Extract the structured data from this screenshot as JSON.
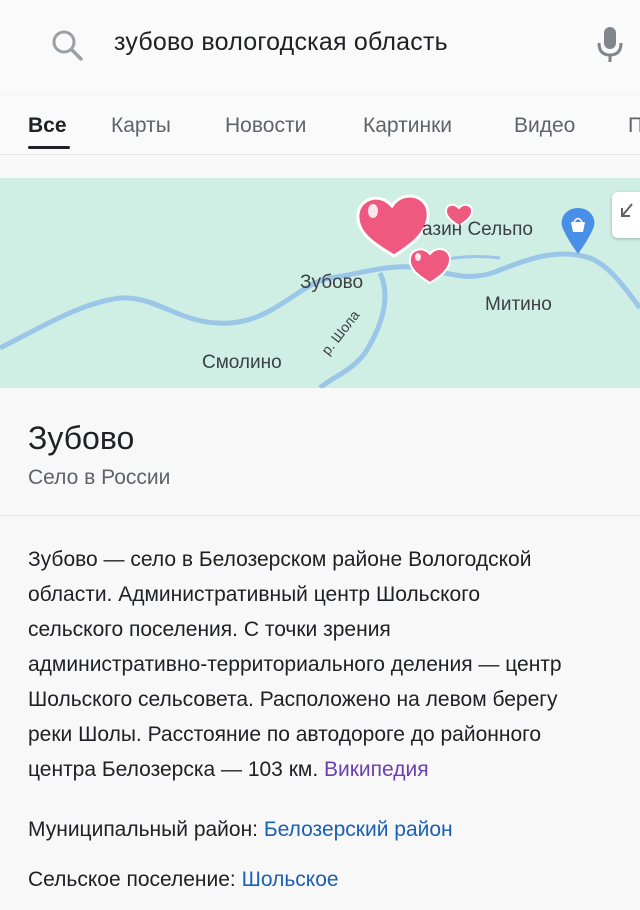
{
  "search": {
    "query": "зубово вологодская область"
  },
  "tabs": [
    {
      "label": "Все",
      "active": true
    },
    {
      "label": "Карты"
    },
    {
      "label": "Новости"
    },
    {
      "label": "Картинки"
    },
    {
      "label": "Видео"
    },
    {
      "label": "П"
    }
  ],
  "map": {
    "labels": {
      "shop": "азин Сельпо",
      "zubovo": "Зубово",
      "mitino": "Митино",
      "smolino": "Смолино",
      "river": "р. Шола"
    },
    "colors": {
      "land": "#cfeee4",
      "river": "#9cc6e8",
      "shop_pin": "#4a8fe7",
      "hearts": "#f0597f"
    }
  },
  "place": {
    "title": "Зубово",
    "subtitle": "Село в России"
  },
  "description": {
    "lines": [
      "Зубово — село в Белозерском районе Вологодской",
      "области. Административный центр Шольского",
      "сельского поселения. С точки зрения",
      "административно-территориального деления — центр",
      "Шольского сельсовета. Расположено на левом берегу",
      "реки Шолы. Расстояние по автодороге до районного",
      "центра Белозерска — 103 км."
    ],
    "source_link": "Википедия"
  },
  "facts": [
    {
      "label": "Муниципальный район:",
      "value": "Белозерский район"
    },
    {
      "label": "Сельское поселение:",
      "value": "Шольское"
    }
  ]
}
